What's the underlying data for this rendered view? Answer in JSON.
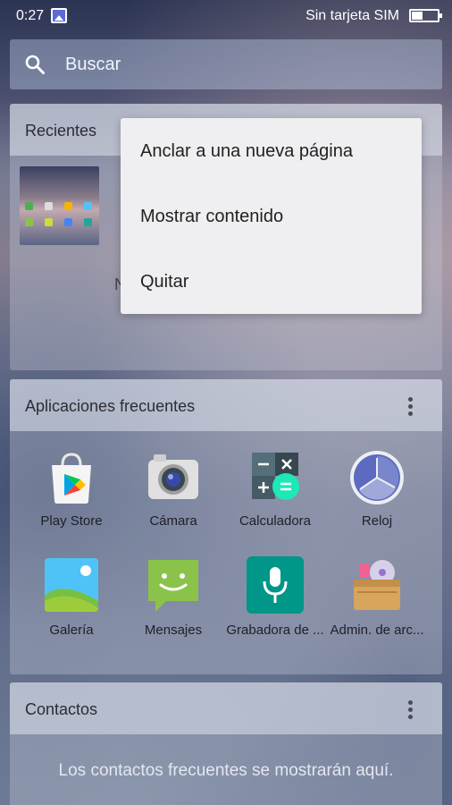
{
  "status_bar": {
    "time": "0:27",
    "carrier": "Sin tarjeta SIM",
    "battery_level": 0.4
  },
  "search": {
    "placeholder": "Buscar"
  },
  "recent": {
    "title": "Recientes",
    "partial_text": "N"
  },
  "context_menu": {
    "items": [
      {
        "label": "Anclar a una nueva página"
      },
      {
        "label": "Mostrar contenido"
      },
      {
        "label": "Quitar"
      }
    ]
  },
  "frequent_apps": {
    "title": "Aplicaciones frecuentes",
    "apps": [
      {
        "label": "Play Store",
        "icon": "play-store-icon"
      },
      {
        "label": "Cámara",
        "icon": "camera-icon"
      },
      {
        "label": "Calculadora",
        "icon": "calculator-icon"
      },
      {
        "label": "Reloj",
        "icon": "clock-icon"
      },
      {
        "label": "Galería",
        "icon": "gallery-icon"
      },
      {
        "label": "Mensajes",
        "icon": "messages-icon"
      },
      {
        "label": "Grabadora de ...",
        "icon": "recorder-icon"
      },
      {
        "label": "Admin. de arc...",
        "icon": "file-manager-icon"
      }
    ]
  },
  "contacts": {
    "title": "Contactos",
    "empty_message": "Los contactos frecuentes se mostrarán aquí."
  }
}
